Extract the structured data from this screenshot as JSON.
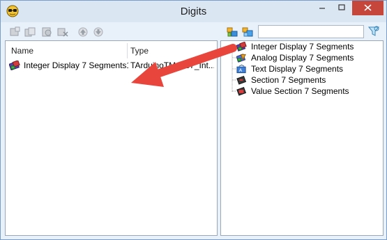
{
  "window": {
    "title": "Digits",
    "controls": {
      "minimize": "minimize",
      "maximize": "maximize",
      "close": "close"
    }
  },
  "toolbar": {
    "left_tools": [
      "add-icon",
      "copy-icon",
      "paste-icon",
      "delete-icon",
      "move-up-icon",
      "move-down-icon"
    ],
    "right_tools": [
      "add-component-icon",
      "add-copy-icon"
    ],
    "search": {
      "value": "",
      "placeholder": ""
    },
    "filter": "filter-icon"
  },
  "components_list": {
    "columns": [
      "Name",
      "Type"
    ],
    "rows": [
      {
        "name": "Integer Display 7 Segments1",
        "type": "TArduinoTM1637_Int..."
      }
    ]
  },
  "component_tree": {
    "items": [
      {
        "label": "Integer Display 7 Segments",
        "icon": "integer-display-icon"
      },
      {
        "label": "Analog Display 7 Segments",
        "icon": "analog-display-icon"
      },
      {
        "label": "Text Display 7 Segments",
        "icon": "text-display-icon"
      },
      {
        "label": "Section 7 Segments",
        "icon": "section-icon"
      },
      {
        "label": "Value Section 7 Segments",
        "icon": "value-section-icon"
      }
    ]
  },
  "annotation": {
    "color": "#e8463c"
  },
  "colors": {
    "close_button": "#c7463c",
    "title_bar": "#dbe6f3",
    "window_bg": "#e8f0fa"
  }
}
